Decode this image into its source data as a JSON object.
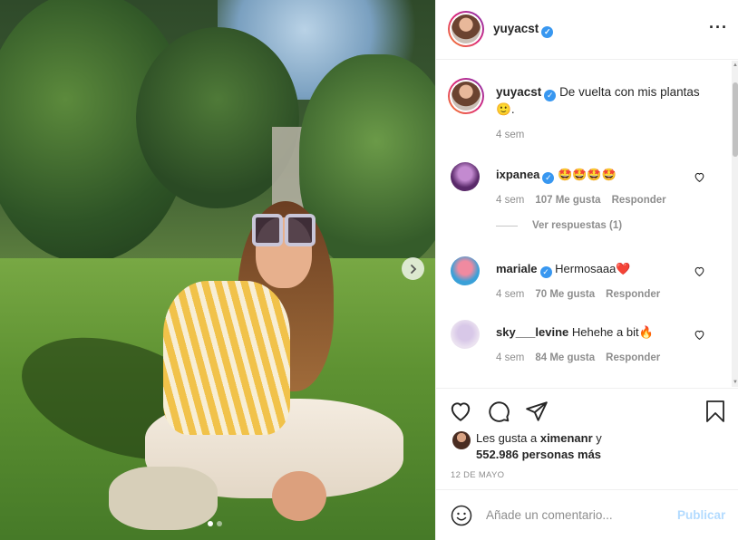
{
  "post": {
    "username": "yuyacst",
    "caption_text": "De vuelta con mis plantas",
    "caption_emoji": "🙂",
    "caption_period": ".",
    "caption_time": "4 sem"
  },
  "comments": [
    {
      "username": "ixpanea",
      "text": "🤩🤩🤩🤩",
      "time": "4 sem",
      "likes": "107 Me gusta",
      "reply": "Responder",
      "verified": true
    },
    {
      "username": "mariale",
      "text": "Hermosaaa❤️",
      "time": "4 sem",
      "likes": "70 Me gusta",
      "reply": "Responder",
      "verified": true
    },
    {
      "username": "sky___levine",
      "text": "Hehehe a bit🔥",
      "time": "4 sem",
      "likes": "84 Me gusta",
      "reply": "Responder",
      "verified": false
    }
  ],
  "view_replies": "Ver respuestas (1)",
  "likes": {
    "prefix": "Les gusta a",
    "first_user": "ximenanr",
    "and": "y",
    "others": "552.986 personas más"
  },
  "date": "12 DE MAYO",
  "add_comment": {
    "placeholder": "Añade un comentario...",
    "post_label": "Publicar"
  },
  "icons": {
    "more": "more-options-icon",
    "heart": "heart-icon",
    "comment": "comment-icon",
    "share": "share-icon",
    "save": "bookmark-icon",
    "emoji": "emoji-icon",
    "next": "chevron-right-icon",
    "verified": "verified-badge-icon"
  },
  "colors": {
    "link_blue": "#3897f0",
    "publish_disabled": "#b3dbff",
    "secondary_text": "#8e8e8e",
    "primary_text": "#262626"
  }
}
